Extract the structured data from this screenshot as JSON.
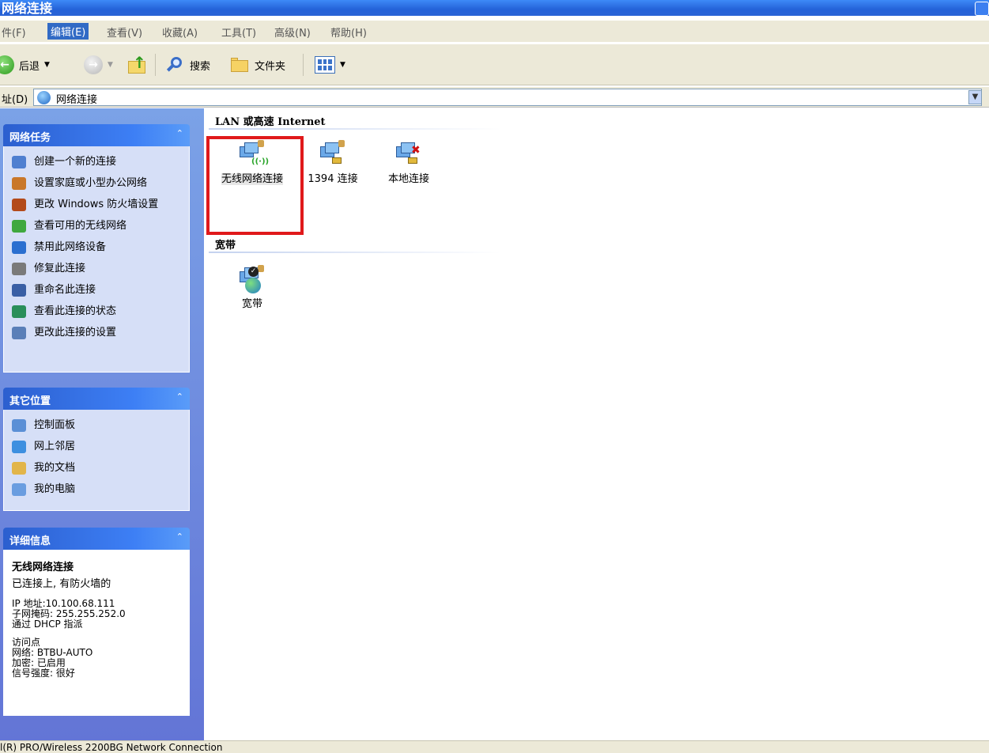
{
  "window": {
    "title": "网络连接"
  },
  "menu": [
    {
      "label": "件(F)",
      "active": false
    },
    {
      "label": "编辑(E)",
      "active": true
    },
    {
      "label": "查看(V)",
      "active": false
    },
    {
      "label": "收藏(A)",
      "active": false
    },
    {
      "label": "工具(T)",
      "active": false
    },
    {
      "label": "高级(N)",
      "active": false
    },
    {
      "label": "帮助(H)",
      "active": false
    }
  ],
  "toolbar": {
    "back_label": "后退",
    "search_label": "搜索",
    "folders_label": "文件夹"
  },
  "address": {
    "label": "址(D)",
    "value": "网络连接"
  },
  "sidebar": {
    "network_tasks": {
      "title": "网络任务",
      "items": [
        {
          "label": "创建一个新的连接",
          "icon": "new-connection-icon",
          "color": "#4f7fd0"
        },
        {
          "label": "设置家庭或小型办公网络",
          "icon": "home-network-icon",
          "color": "#c9772a"
        },
        {
          "label": "更改 Windows 防火墙设置",
          "icon": "firewall-icon",
          "color": "#b34a1a"
        },
        {
          "label": "查看可用的无线网络",
          "icon": "wireless-icon",
          "color": "#3fa83f"
        },
        {
          "label": "禁用此网络设备",
          "icon": "disable-device-icon",
          "color": "#2b6fd0"
        },
        {
          "label": "修复此连接",
          "icon": "repair-icon",
          "color": "#7a7a7a"
        },
        {
          "label": "重命名此连接",
          "icon": "rename-icon",
          "color": "#3a5fa5"
        },
        {
          "label": "查看此连接的状态",
          "icon": "status-icon",
          "color": "#2a8f5a"
        },
        {
          "label": "更改此连接的设置",
          "icon": "settings-icon",
          "color": "#5a7fb8"
        }
      ]
    },
    "other_places": {
      "title": "其它位置",
      "items": [
        {
          "label": "控制面板",
          "icon": "control-panel-icon",
          "color": "#5b8fd6"
        },
        {
          "label": "网上邻居",
          "icon": "network-places-icon",
          "color": "#3d8fe0"
        },
        {
          "label": "我的文档",
          "icon": "my-documents-icon",
          "color": "#e2b54a"
        },
        {
          "label": "我的电脑",
          "icon": "my-computer-icon",
          "color": "#6a9de0"
        }
      ]
    },
    "details": {
      "title": "详细信息",
      "name": "无线网络连接",
      "status": "已连接上, 有防火墙的",
      "lines_a": [
        "IP 地址:10.100.68.111",
        "子网掩码: 255.255.252.0",
        "通过 DHCP 指派"
      ],
      "lines_b": [
        "访问点",
        "网络: BTBU-AUTO",
        "加密: 已启用",
        "信号强度: 很好"
      ]
    }
  },
  "content": {
    "group_lan": {
      "title": "LAN 或高速 Internet",
      "items": [
        {
          "label": "无线网络连接",
          "selected": true
        },
        {
          "label": "1394 连接",
          "selected": false
        },
        {
          "label": "本地连接",
          "selected": false
        }
      ]
    },
    "group_broadband": {
      "title": "宽带",
      "items": [
        {
          "label": "宽带",
          "selected": false
        }
      ]
    }
  },
  "statusbar": {
    "text": "l(R) PRO/Wireless 2200BG Network Connection"
  },
  "colors": {
    "highlight_box": "#e0191b",
    "title_bar": "#2462d8",
    "sidebar_bg": "#6f8ee0"
  }
}
